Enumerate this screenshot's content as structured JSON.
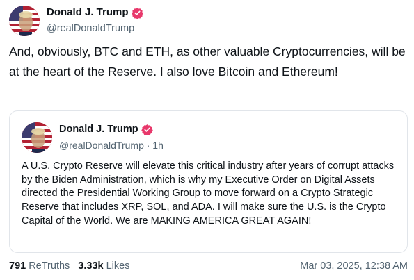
{
  "post": {
    "author": {
      "display_name": "Donald J. Trump",
      "handle": "@realDonaldTrump",
      "verified_icon": "verified-badge-icon"
    },
    "text": "And, obviously, BTC and ETH, as other valuable Cryptocurrencies, will be at the heart of the Reserve. I also love Bitcoin and Ethereum!"
  },
  "quote": {
    "author": {
      "display_name": "Donald J. Trump",
      "handle": "@realDonaldTrump · 1h"
    },
    "text": "A U.S. Crypto Reserve will elevate this critical industry after years of corrupt attacks by the Biden Administration, which is why my Executive Order on Digital Assets directed the Presidential Working Group to move forward on a Crypto Strategic Reserve that includes XRP, SOL, and ADA. I will make sure the U.S. is the Crypto Capital of the World. We are MAKING AMERICA GREAT AGAIN!"
  },
  "footer": {
    "retruths_count": "791",
    "retruths_label": "ReTruths",
    "likes_count": "3.33k",
    "likes_label": "Likes",
    "timestamp": "Mar 03, 2025, 12:38 AM"
  },
  "colors": {
    "badge": "#e8386b",
    "secondary_text": "#536471",
    "border": "#e1e5ea"
  }
}
